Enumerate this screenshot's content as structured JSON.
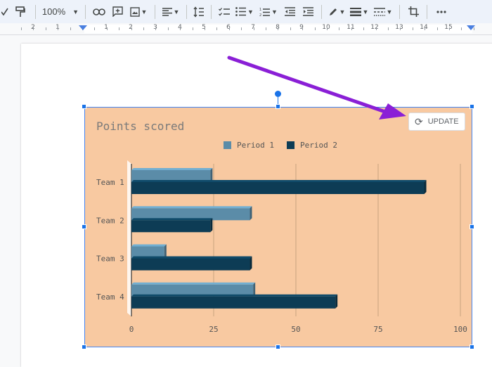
{
  "toolbar": {
    "zoom": "100%",
    "icons": [
      "spellcheck-icon",
      "paint-format-icon",
      "zoom-select",
      "link-icon",
      "add-comment-icon",
      "insert-image-icon",
      "align-icon",
      "line-spacing-icon",
      "checklist-icon",
      "bulleted-list-icon",
      "numbered-list-icon",
      "decrease-indent-icon",
      "increase-indent-icon",
      "border-color-icon",
      "border-weight-icon",
      "border-dash-icon",
      "crop-icon",
      "more-icon"
    ]
  },
  "ruler": {
    "labels": [
      "2",
      "1",
      "1",
      "2",
      "3",
      "4",
      "5",
      "6",
      "7",
      "8",
      "9",
      "10",
      "11",
      "12",
      "13",
      "14",
      "15"
    ]
  },
  "update_button": {
    "label": "UPDATE"
  },
  "chart_data": {
    "type": "bar",
    "orientation": "horizontal",
    "style": "3d",
    "title": "Points scored",
    "categories": [
      "Team 1",
      "Team 2",
      "Team 3",
      "Team 4"
    ],
    "series": [
      {
        "name": "Period 1",
        "values": [
          24,
          36,
          10,
          37
        ],
        "color": "#5b8ca8"
      },
      {
        "name": "Period 2",
        "values": [
          89,
          24,
          36,
          62
        ],
        "color": "#0d3c55"
      }
    ],
    "xlim": [
      0,
      100
    ],
    "xticks": [
      "0",
      "25",
      "50",
      "75",
      "100"
    ],
    "grid": true,
    "legend": "top",
    "background": "#f8c9a1"
  },
  "colors": {
    "selection": "#1a73e8",
    "arrow": "#8a1fd6"
  }
}
